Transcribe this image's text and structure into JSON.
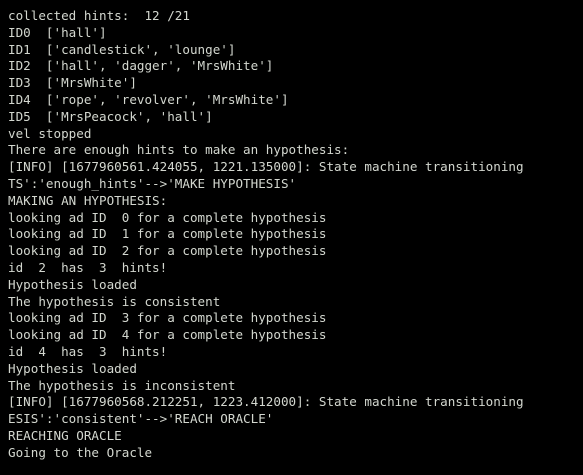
{
  "terminal": {
    "background": "#000000",
    "foreground": "#d3d7cf",
    "lines": [
      "collected hints:  12 /21",
      "ID0  ['hall']",
      "ID1  ['candlestick', 'lounge']",
      "ID2  ['hall', 'dagger', 'MrsWhite']",
      "ID3  ['MrsWhite']",
      "ID4  ['rope', 'revolver', 'MrsWhite']",
      "ID5  ['MrsPeacock', 'hall']",
      "vel stopped",
      "There are enough hints to make an hypothesis:",
      "[INFO] [1677960561.424055, 1221.135000]: State machine transitioning",
      "TS':'enough_hints'-->'MAKE HYPOTHESIS'",
      "MAKING AN HYPOTHESIS:",
      "looking ad ID  0 for a complete hypothesis",
      "looking ad ID  1 for a complete hypothesis",
      "looking ad ID  2 for a complete hypothesis",
      "id  2  has  3  hints!",
      "Hypothesis loaded",
      "The hypothesis is consistent",
      "looking ad ID  3 for a complete hypothesis",
      "looking ad ID  4 for a complete hypothesis",
      "id  4  has  3  hints!",
      "Hypothesis loaded",
      "The hypothesis is inconsistent",
      "[INFO] [1677960568.212251, 1223.412000]: State machine transitioning",
      "ESIS':'consistent'-->'REACH ORACLE'",
      "REACHING ORACLE",
      "Going to the Oracle"
    ]
  }
}
